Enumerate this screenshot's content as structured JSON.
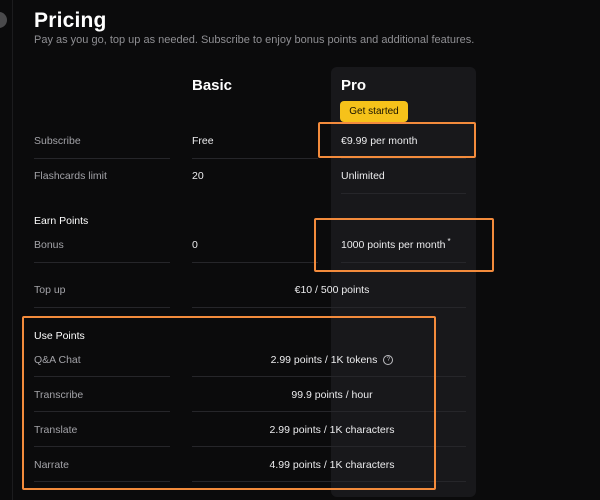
{
  "header": {
    "title": "Pricing",
    "subtitle": "Pay as you go, top up as needed. Subscribe to enjoy bonus points and additional features."
  },
  "plans": {
    "basic": {
      "name": "Basic"
    },
    "pro": {
      "name": "Pro",
      "cta_label": "Get started"
    }
  },
  "rows": {
    "subscribe": {
      "label": "Subscribe",
      "basic": "Free",
      "pro": "€9.99 per month"
    },
    "flashcards": {
      "label": "Flashcards limit",
      "basic": "20",
      "pro": "Unlimited"
    },
    "earn_points": {
      "label": "Earn Points"
    },
    "bonus": {
      "label": "Bonus",
      "basic": "0",
      "pro": "1000 points per month",
      "pro_note": "*"
    },
    "topup": {
      "label": "Top up",
      "value": "€10 / 500 points"
    },
    "use_points": {
      "label": "Use Points"
    },
    "qa_chat": {
      "label": "Q&A Chat",
      "value": "2.99 points / 1K tokens",
      "help_icon": "?"
    },
    "transcribe": {
      "label": "Transcribe",
      "value": "99.9 points / hour"
    },
    "translate": {
      "label": "Translate",
      "value": "2.99 points / 1K characters"
    },
    "narrate": {
      "label": "Narrate",
      "value": "4.99 points / 1K characters"
    }
  },
  "colors": {
    "background": "#0b0b0c",
    "pro_panel": "#18181b",
    "accent_button": "#f6c21a",
    "highlight_box": "#f38b3c"
  }
}
